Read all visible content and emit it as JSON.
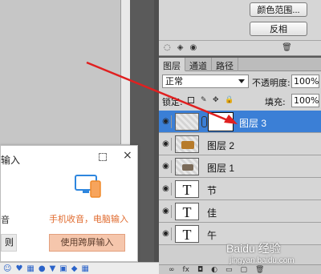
{
  "channels": {
    "color_range_label": "颜色范围...",
    "invert_label": "反相"
  },
  "layers": {
    "tabs": [
      {
        "label": "图层"
      },
      {
        "label": "通道"
      },
      {
        "label": "路径"
      }
    ],
    "blend_mode": "正常",
    "opacity_label": "不透明度:",
    "opacity_value": "100%",
    "lock_label": "锁定:",
    "fill_label": "填充:",
    "fill_value": "100%",
    "items": [
      {
        "name": "图层 3",
        "selected": true,
        "type": "pixel-with-mask"
      },
      {
        "name": "图层 2",
        "selected": false,
        "type": "pixel"
      },
      {
        "name": "图层 1",
        "selected": false,
        "type": "pixel"
      },
      {
        "name": "节",
        "selected": false,
        "type": "text"
      },
      {
        "name": "佳",
        "selected": false,
        "type": "text"
      },
      {
        "name": "午",
        "selected": false,
        "type": "text"
      }
    ],
    "text_thumb_glyph": "T"
  },
  "ime": {
    "title_fragment": "输入",
    "left_text_fragment": "音",
    "right_text": "手机收音，电脑输入",
    "left_button_fragment": "则",
    "right_button": "使用跨屏输入",
    "accent_color": "#e06b2f"
  },
  "annotation": {
    "arrow_color": "#e02020"
  },
  "watermark": {
    "brand": "Baidu 经验",
    "sub": "jingyan.baidu.com"
  }
}
